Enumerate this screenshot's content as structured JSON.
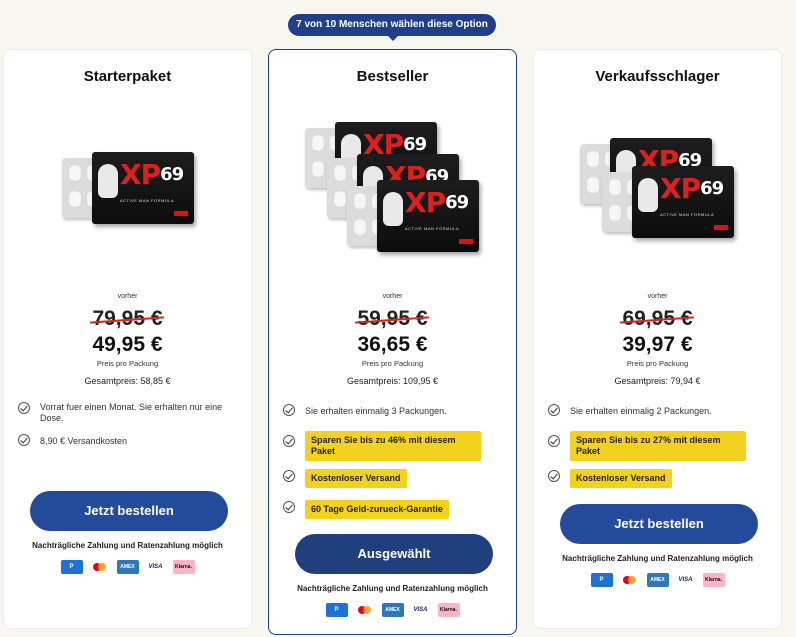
{
  "ribbon": {
    "text": "7 von 10 Menschen wählen diese Option"
  },
  "colors": {
    "primary": "#234b9a",
    "highlight": "#f3d11c",
    "strike": "#d4271b",
    "brand_red": "#e01e1e"
  },
  "product": {
    "brand": "XP",
    "brand_num": "69",
    "tagline": "ACTIVE MAN FORMULA"
  },
  "icons": [
    "check-circle-icon",
    "paypal-icon",
    "mastercard-icon",
    "amex-icon",
    "visa-icon",
    "klarna-icon"
  ],
  "payment": {
    "paypal": "P",
    "amex": "AMEX",
    "visa": "VISA",
    "klarna": "Klarna."
  },
  "cards": [
    {
      "title": "Starterpaket",
      "vorher": "vorher",
      "old_price": "79,95 €",
      "new_price": "49,95 €",
      "per_pack": "Preis pro Packung",
      "total": "Gesamtpreis: 58,85 €",
      "features": [
        {
          "text": "Vorrat fuer einen Monat. Sie erhalten nur eine Dose.",
          "highlight": false
        },
        {
          "text": "8,90 € Versandkosten",
          "highlight": false
        }
      ],
      "button": "Jetzt bestellen",
      "note": "Nachträgliche Zahlung und Ratenzahlung möglich"
    },
    {
      "title": "Bestseller",
      "vorher": "vorher",
      "old_price": "59,95 €",
      "new_price": "36,65 €",
      "per_pack": "Preis pro Packung",
      "total": "Gesamtpreis: 109,95 €",
      "features": [
        {
          "text": "Sie erhalten einmalig 3 Packungen.",
          "highlight": false
        },
        {
          "text": "Sparen Sie bis zu 46% mit diesem Paket",
          "highlight": true
        },
        {
          "text": "Kostenloser Versand",
          "highlight": true
        },
        {
          "text": "60 Tage Geld-zurueck-Garantie",
          "highlight": true
        }
      ],
      "button": "Ausgewählt",
      "note": "Nachträgliche Zahlung und Ratenzahlung möglich"
    },
    {
      "title": "Verkaufsschlager",
      "vorher": "vorher",
      "old_price": "69,95 €",
      "new_price": "39,97 €",
      "per_pack": "Preis pro Packung",
      "total": "Gesamtpreis: 79,94 €",
      "features": [
        {
          "text": "Sie erhalten einmalig 2 Packungen.",
          "highlight": false
        },
        {
          "text": "Sparen Sie bis zu 27% mit diesem Paket",
          "highlight": true
        },
        {
          "text": "Kostenloser Versand",
          "highlight": true
        }
      ],
      "button": "Jetzt bestellen",
      "note": "Nachträgliche Zahlung und Ratenzahlung möglich"
    }
  ]
}
